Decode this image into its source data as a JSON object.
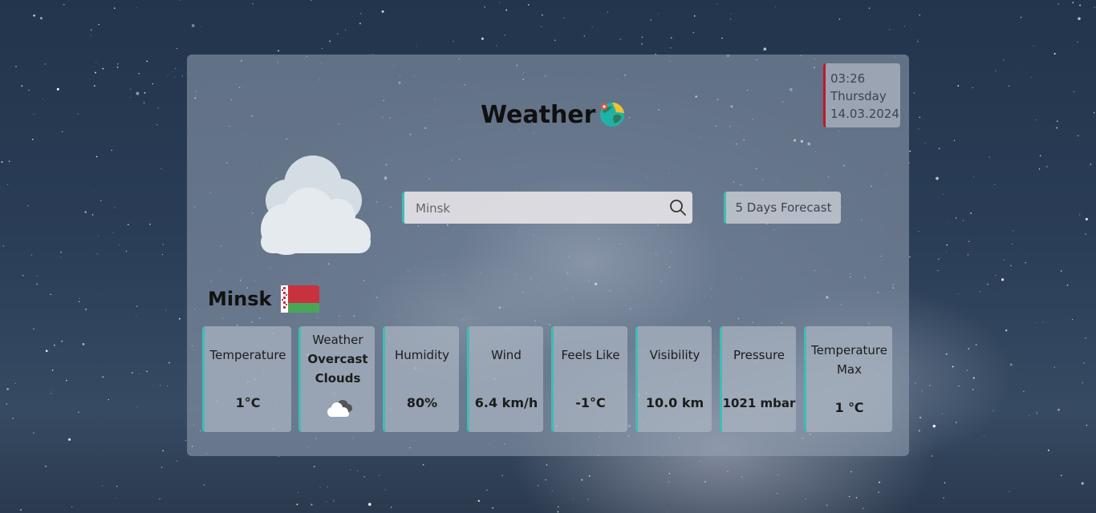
{
  "datetime": {
    "time": "03:26",
    "day": "Thursday",
    "date": "14.03.2024"
  },
  "header": {
    "title": "Weather",
    "globe_icon": "globe-icon"
  },
  "current": {
    "condition_icon": "cloud-icon"
  },
  "search": {
    "value": "Minsk",
    "placeholder": "",
    "icon": "search-icon"
  },
  "forecast_button": {
    "label": "5 Days Forecast"
  },
  "location": {
    "city": "Minsk",
    "flag_icon": "belarus-flag-icon"
  },
  "metrics": [
    {
      "label": "Temperature",
      "value": "1°C"
    },
    {
      "label": "Weather",
      "condition": "Overcast Clouds",
      "icon": "cloud-icon"
    },
    {
      "label": "Humidity",
      "value": "80%"
    },
    {
      "label": "Wind",
      "value": "6.4 km/h"
    },
    {
      "label": "Feels Like",
      "value": "-1°C"
    },
    {
      "label": "Visibility",
      "value": "10.0 km"
    },
    {
      "label": "Pressure",
      "value": "1021 mbar"
    },
    {
      "label_line1": "Temperature",
      "label_line2": "Max",
      "value": "1 ℃"
    }
  ],
  "colors": {
    "accent": "#3fbdb5",
    "datetime_border": "#c0182a",
    "text": "#111111"
  }
}
